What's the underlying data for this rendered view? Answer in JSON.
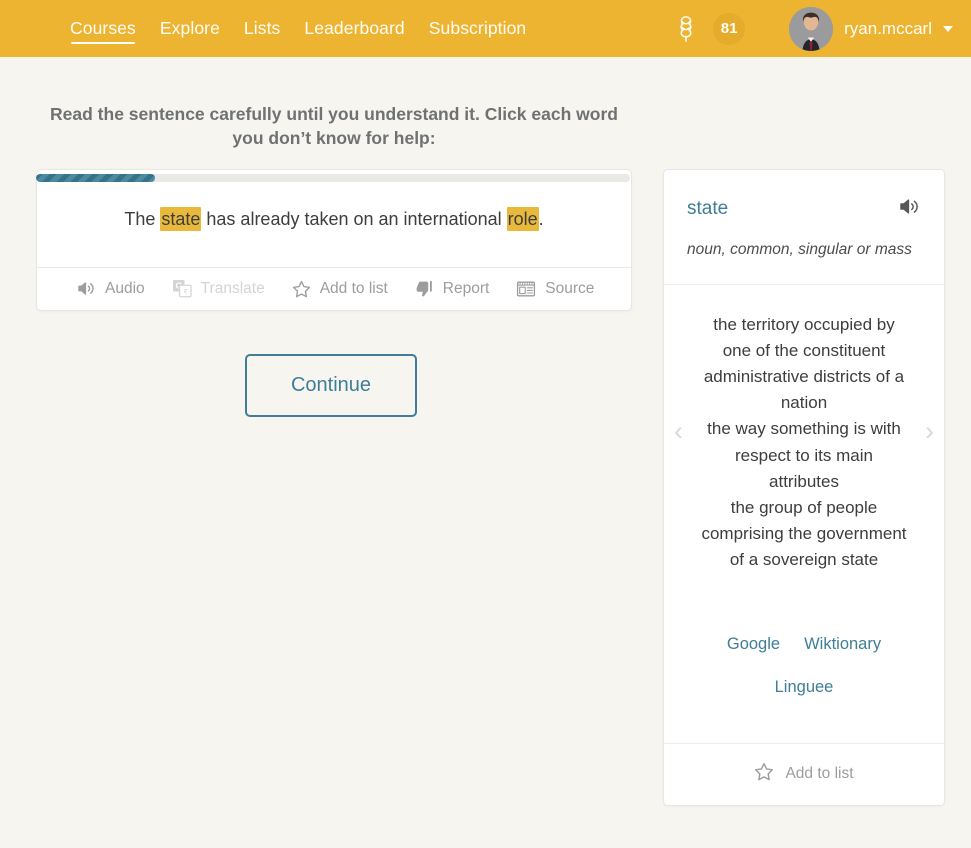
{
  "header": {
    "nav": [
      {
        "label": "Courses",
        "active": true
      },
      {
        "label": "Explore",
        "active": false
      },
      {
        "label": "Lists",
        "active": false
      },
      {
        "label": "Leaderboard",
        "active": false
      },
      {
        "label": "Subscription",
        "active": false
      }
    ],
    "streak_icon": "hop-cone-icon",
    "streak_count": "81",
    "username": "ryan.mccarl",
    "avatar_alt": "user-avatar",
    "background_color": "#edb431",
    "text_color": "#fffdf7"
  },
  "progress": {
    "percent": 20,
    "fill_color": "#3f7e96",
    "track_color": "#e9e9e6"
  },
  "instructions": "Read the sentence carefully until you understand it. Click each word you don’t know for help:",
  "sentence": {
    "parts": [
      {
        "text": "The ",
        "highlight": false
      },
      {
        "text": "state",
        "highlight": true
      },
      {
        "text": " has already taken on an international ",
        "highlight": false
      },
      {
        "text": "role",
        "highlight": true
      },
      {
        "text": ".",
        "highlight": false
      }
    ],
    "highlight_color": "#e8b93a"
  },
  "card_toolbar": [
    {
      "label": "Audio",
      "icon": "speaker-icon",
      "disabled": false
    },
    {
      "label": "Translate",
      "icon": "google-translate-icon",
      "disabled": true
    },
    {
      "label": "Add to list",
      "icon": "star-icon",
      "disabled": false
    },
    {
      "label": "Report",
      "icon": "thumbs-down-icon",
      "disabled": false
    },
    {
      "label": "Source",
      "icon": "newspaper-icon",
      "disabled": false
    }
  ],
  "continue_label": "Continue",
  "definition_panel": {
    "word": "state",
    "audio_icon": "speaker-icon",
    "part_of_speech": "noun, common, singular or mass",
    "definitions": [
      "the territory occupied by one of the constituent administrative districts of a nation",
      "the way something is with respect to its main attributes",
      "the group of people comprising the government of a sovereign state"
    ],
    "prev_icon": "chevron-left-icon",
    "next_icon": "chevron-right-icon",
    "prev_glyph": "‹",
    "next_glyph": "›",
    "links": [
      {
        "label": "Google"
      },
      {
        "label": "Wiktionary"
      },
      {
        "label": "Linguee"
      }
    ],
    "footer_action": {
      "label": "Add to list",
      "icon": "star-icon"
    },
    "accent_color": "#3f7e96"
  }
}
